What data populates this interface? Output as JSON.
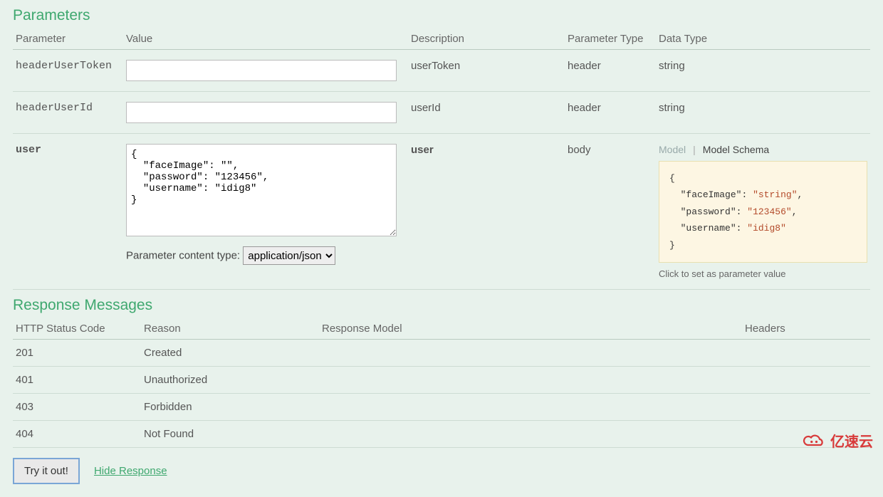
{
  "sections": {
    "parameters_title": "Parameters",
    "responses_title": "Response Messages"
  },
  "columns": {
    "parameter": "Parameter",
    "value": "Value",
    "description": "Description",
    "parameter_type": "Parameter Type",
    "data_type": "Data Type"
  },
  "params": [
    {
      "name": "headerUserToken",
      "input_value": "",
      "description": "userToken",
      "param_type": "header",
      "data_type": "string"
    },
    {
      "name": "headerUserId",
      "input_value": "",
      "description": "userId",
      "param_type": "header",
      "data_type": "string"
    },
    {
      "name": "user",
      "body_value": "{\n  \"faceImage\": \"\",\n  \"password\": \"123456\",\n  \"username\": \"idig8\"\n}",
      "description": "user",
      "param_type": "body"
    }
  ],
  "content_type": {
    "label": "Parameter content type:",
    "selected": "application/json"
  },
  "schema": {
    "toggle_model": "Model",
    "toggle_schema": "Model Schema",
    "hint": "Click to set as parameter value",
    "fields": [
      {
        "key": "faceImage",
        "value": "string"
      },
      {
        "key": "password",
        "value": "123456"
      },
      {
        "key": "username",
        "value": "idig8"
      }
    ]
  },
  "response_columns": {
    "code": "HTTP Status Code",
    "reason": "Reason",
    "model": "Response Model",
    "headers": "Headers"
  },
  "responses": [
    {
      "code": "201",
      "reason": "Created"
    },
    {
      "code": "401",
      "reason": "Unauthorized"
    },
    {
      "code": "403",
      "reason": "Forbidden"
    },
    {
      "code": "404",
      "reason": "Not Found"
    }
  ],
  "actions": {
    "try": "Try it out!",
    "hide": "Hide Response"
  },
  "watermark": "亿速云"
}
